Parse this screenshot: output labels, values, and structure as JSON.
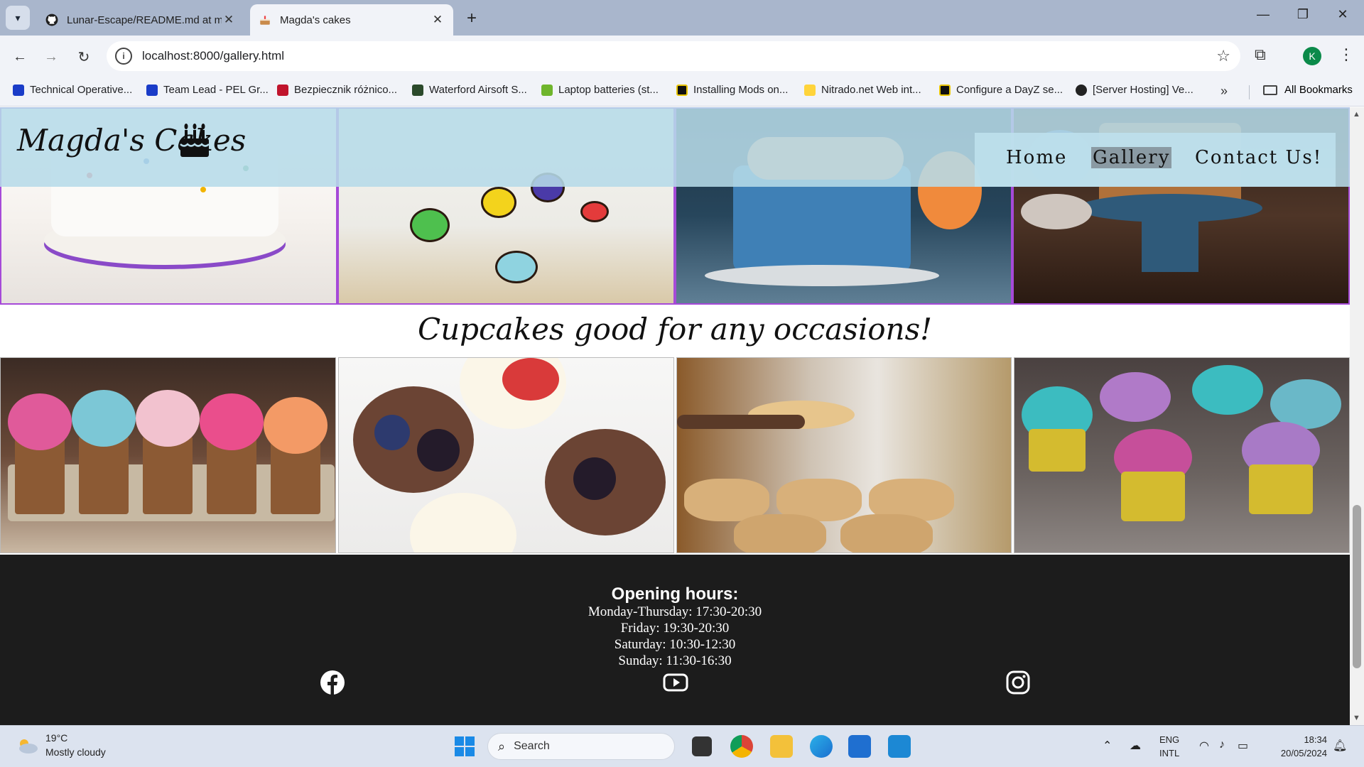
{
  "browser": {
    "tabs": [
      {
        "title": "Lunar-Escape/README.md at m",
        "active": false
      },
      {
        "title": "Magda's cakes",
        "active": true
      }
    ],
    "url": "localhost:8000/gallery.html",
    "profile_initial": "K",
    "bookmarks": [
      "Technical Operative...",
      "Team Lead - PEL Gr...",
      "Bezpiecznik różnico...",
      "Waterford Airsoft S...",
      "Laptop batteries (st...",
      "Installing Mods on...",
      "Nitrado.net Web int...",
      "Configure a DayZ se...",
      "[Server Hosting] Ve..."
    ],
    "all_bookmarks": "All Bookmarks"
  },
  "site": {
    "logo": "Magda's Cakes",
    "nav": [
      "Home",
      "Gallery",
      "Contact Us!"
    ],
    "active_nav": "Gallery",
    "cupcakes_heading": "Cupcakes good for any occasions!",
    "footer": {
      "hours_title": "Opening hours:",
      "hours": [
        "Monday-Thursday: 17:30-20:30",
        "Friday: 19:30-20:30",
        "Saturday: 10:30-12:30",
        "Sunday: 11:30-16:30"
      ],
      "social": [
        "facebook-icon",
        "youtube-icon",
        "instagram-icon"
      ]
    }
  },
  "taskbar": {
    "weather_temp": "19°C",
    "weather_desc": "Mostly cloudy",
    "search_placeholder": "Search",
    "lang_line1": "ENG",
    "lang_line2": "INTL",
    "time": "18:34",
    "date": "20/05/2024"
  },
  "colors": {
    "header_bg": "#b6dbe8",
    "image_border": "#a64ad8",
    "footer_bg": "#1c1c1c",
    "active_nav_bg": "#8a9aa3"
  }
}
